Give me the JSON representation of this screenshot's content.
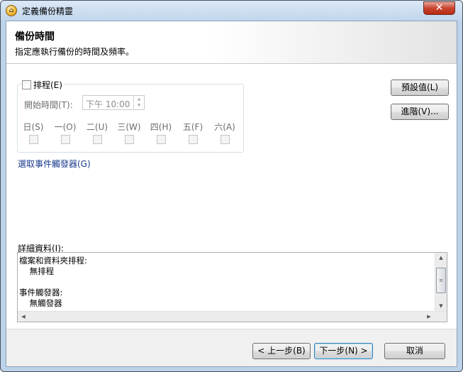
{
  "window": {
    "title": "定義備份精靈",
    "icon": "backup-wizard-icon",
    "close_glyph": "✕"
  },
  "header": {
    "title": "備份時間",
    "subtitle": "指定應執行備份的時間及頻率。"
  },
  "schedule": {
    "checkbox_label": "排程(E)",
    "checked": false,
    "start_time_label": "開始時間(T):",
    "start_time_value": "下午 10:00",
    "days": [
      {
        "label": "日(S)"
      },
      {
        "label": "一(O)"
      },
      {
        "label": "二(U)"
      },
      {
        "label": "三(W)"
      },
      {
        "label": "四(H)"
      },
      {
        "label": "五(F)"
      },
      {
        "label": "六(A)"
      }
    ]
  },
  "event_trigger_link": "選取事件觸發器(G)",
  "side_buttons": {
    "defaults": "預設值(L)",
    "advanced": "進階(V)..."
  },
  "details": {
    "label": "詳細資料(I):",
    "lines": [
      "檔案和資料夾排程:",
      "    無排程",
      "",
      "事件觸發器:",
      "    無觸發器"
    ]
  },
  "footer": {
    "back": "< 上一步(B)",
    "next": "下一步(N) >",
    "cancel": "取消"
  },
  "colors": {
    "titlebar": "#c1d6ec",
    "close_button": "#c7452f",
    "link": "#1a3a8c"
  }
}
